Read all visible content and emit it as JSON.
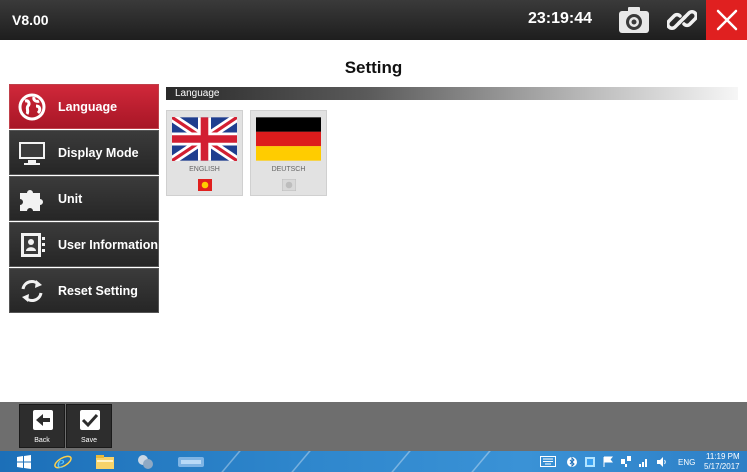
{
  "window": {
    "version": "V8.00",
    "clock": "23:19:44",
    "title": "Setting"
  },
  "menu": {
    "items": [
      {
        "label": "Language",
        "icon": "globe-icon",
        "active": true
      },
      {
        "label": "Display Mode",
        "icon": "monitor-icon",
        "active": false
      },
      {
        "label": "Unit",
        "icon": "puzzle-icon",
        "active": false
      },
      {
        "label": "User Information",
        "icon": "user-card-icon",
        "active": false
      },
      {
        "label": "Reset Setting",
        "icon": "refresh-icon",
        "active": false
      }
    ]
  },
  "content": {
    "section_header": "Language",
    "languages": [
      {
        "name": "ENGLISH",
        "selected": true
      },
      {
        "name": "DEUTSCH",
        "selected": false
      }
    ]
  },
  "toolbar": {
    "back_label": "Back",
    "save_label": "Save"
  },
  "taskbar": {
    "lang": "ENG",
    "time": "11:19 PM",
    "date": "5/17/2017"
  },
  "colors": {
    "accent_red": "#c8202f",
    "close_red": "#e02020",
    "taskbar_blue": "#2e86cc"
  }
}
